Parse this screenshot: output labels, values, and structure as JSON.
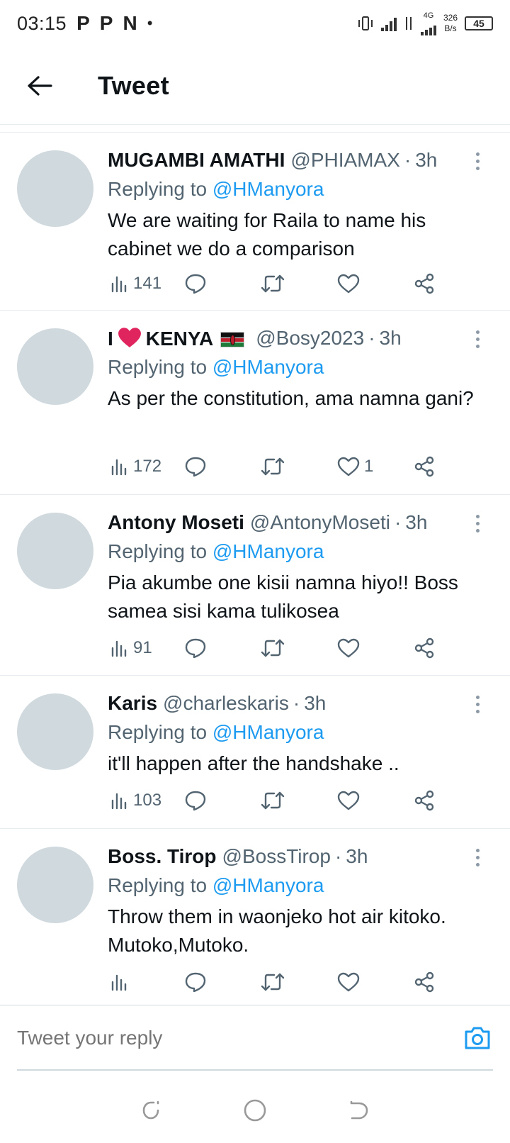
{
  "status_bar": {
    "time": "03:15",
    "app_indicators": [
      "P",
      "P",
      "N"
    ],
    "dot": "•",
    "network_speed_value": "326",
    "network_speed_unit": "B/s",
    "network_type": "4G",
    "battery": "45"
  },
  "header": {
    "title": "Tweet"
  },
  "tweets": [
    {
      "name": "MUGAMBI AMATHI",
      "handle": "@PHIAMAX",
      "sep": "·",
      "time": "3h",
      "replying_prefix": "Replying to",
      "replying_to": "@HManyora",
      "text": "We are waiting for Raila to name his cabinet we do a comparison",
      "views": "141",
      "likes": ""
    },
    {
      "name_part1": "I",
      "name_part2": "KENYA",
      "handle": "@Bosy2023",
      "sep": "·",
      "time": "3h",
      "replying_prefix": "Replying to",
      "replying_to": "@HManyora",
      "text": "As per the constitution, ama namna gani?",
      "views": "172",
      "likes": "1"
    },
    {
      "name": "Antony Moseti",
      "handle": "@AntonyMoseti",
      "sep": "·",
      "time": "3h",
      "replying_prefix": "Replying to",
      "replying_to": "@HManyora",
      "text": "Pia akumbe one kisii namna hiyo!! Boss samea sisi kama tulikosea",
      "views": "91",
      "likes": ""
    },
    {
      "name": "Karis",
      "handle": "@charleskaris",
      "sep": "·",
      "time": "3h",
      "replying_prefix": "Replying to",
      "replying_to": "@HManyora",
      "text": "it'll happen after the handshake ..",
      "views": "103",
      "likes": ""
    },
    {
      "name": "Boss. Tirop",
      "handle": "@BossTirop",
      "sep": "·",
      "time": "3h",
      "replying_prefix": "Replying to",
      "replying_to": "@HManyora",
      "text": "Throw them in waonjeko hot air kitoko. Mutoko,Mutoko.",
      "views": "",
      "likes": ""
    }
  ],
  "reply_bar": {
    "placeholder": "Tweet your reply"
  },
  "colors": {
    "accent": "#1d9bf0",
    "text": "#0f1419",
    "secondary": "#536471",
    "avatar": "#cfd9de",
    "heart": "#e0245e"
  },
  "icons": {
    "back": "arrow-left-icon",
    "more": "more-vertical-icon",
    "views": "views-icon",
    "reply": "reply-icon",
    "retweet": "retweet-icon",
    "like": "heart-icon",
    "share": "share-icon",
    "camera": "camera-icon",
    "nav_recent": "recents-icon",
    "nav_home": "home-icon",
    "nav_back": "back-icon"
  }
}
